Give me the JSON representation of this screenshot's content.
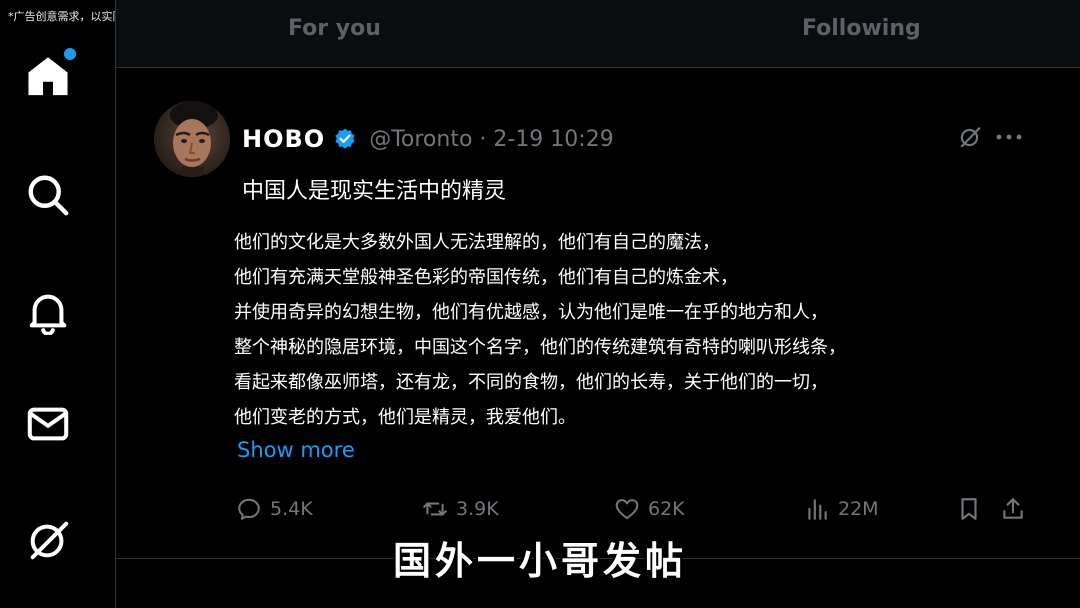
{
  "disclaimer": "*广告创意需求，以实际游戏体验为准",
  "sidebar": {
    "items": [
      {
        "name": "home",
        "has_notification": true
      },
      {
        "name": "search"
      },
      {
        "name": "notifications"
      },
      {
        "name": "messages"
      },
      {
        "name": "grok"
      }
    ]
  },
  "tabs": {
    "for_you": "For you",
    "following": "Following"
  },
  "tweet": {
    "author_name": "HOBO",
    "verified": true,
    "handle_time": "@Toronto · 2-19 10:29",
    "title": "中国人是现实生活中的精灵",
    "lines": [
      "他们的文化是大多数外国人无法理解的，他们有自己的魔法，",
      "他们有充满天堂般神圣色彩的帝国传统，他们有自己的炼金术，",
      "并使用奇异的幻想生物，他们有优越感，认为他们是唯一在乎的地方和人，",
      "整个神秘的隐居环境，中国这个名字，他们的传统建筑有奇特的喇叭形线条，",
      "看起来都像巫师塔，还有龙，不同的食物，他们的长寿，关于他们的一切，",
      "他们变老的方式，他们是精灵，我爱他们。"
    ],
    "show_more": "Show more",
    "stats": {
      "replies": "5.4K",
      "reposts": "3.9K",
      "likes": "62K",
      "views": "22M"
    }
  },
  "caption": "国外一小哥发帖",
  "colors": {
    "accent": "#1d9bf0",
    "muted": "#71767b",
    "text": "#ffffff",
    "background": "#000000"
  }
}
